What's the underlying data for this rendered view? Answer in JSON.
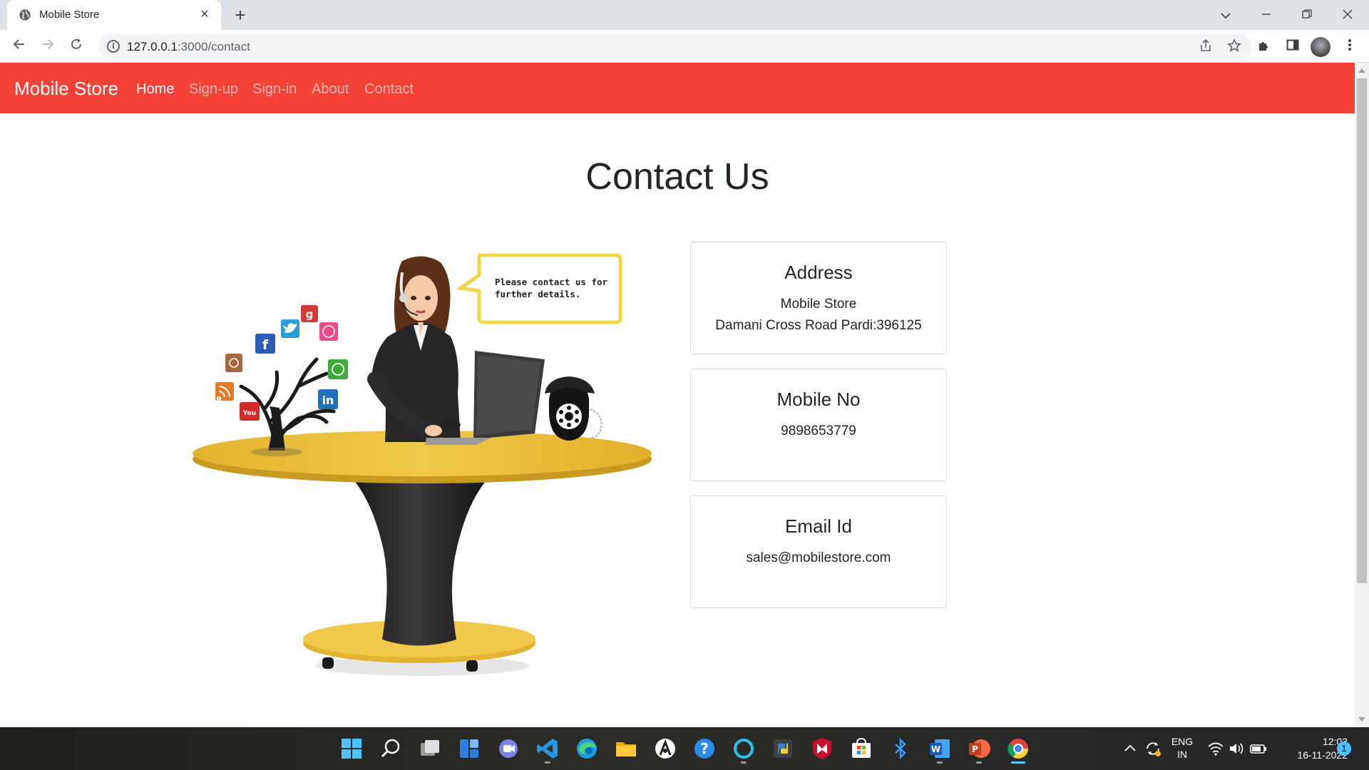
{
  "browser": {
    "tab_title": "Mobile Store",
    "url_host": "127.0.0.1",
    "url_path": ":3000/contact"
  },
  "navbar": {
    "brand": "Mobile Store",
    "links": [
      "Home",
      "Sign-up",
      "Sign-in",
      "About",
      "Contact"
    ],
    "active": "Home",
    "bg_color": "#f44336"
  },
  "page": {
    "title": "Contact Us",
    "illustration": {
      "speech_bubble_line1": "Please contact us for",
      "speech_bubble_line2": "further details.",
      "social_icons": [
        "google-plus",
        "twitter",
        "dribbble",
        "facebook",
        "instagram",
        "whatsapp",
        "rss",
        "linkedin",
        "youtube"
      ]
    },
    "cards": [
      {
        "title": "Address",
        "line1": "Mobile Store",
        "line2": "Damani Cross Road Pardi:396125"
      },
      {
        "title": "Mobile No",
        "line1": "9898653779"
      },
      {
        "title": "Email Id",
        "line1": "sales@mobilestore.com"
      }
    ]
  },
  "taskbar": {
    "apps": [
      "windows-start",
      "search",
      "task-view",
      "widgets",
      "teams-chat",
      "vscode",
      "edge",
      "file-explorer",
      "app-circle",
      "help",
      "cortana",
      "python",
      "mcafee",
      "store",
      "bluetooth",
      "word",
      "powerpoint",
      "chrome"
    ],
    "lang_line1": "ENG",
    "lang_line2": "IN",
    "time": "12:03",
    "date": "16-11-2022",
    "notification_count": "1"
  }
}
